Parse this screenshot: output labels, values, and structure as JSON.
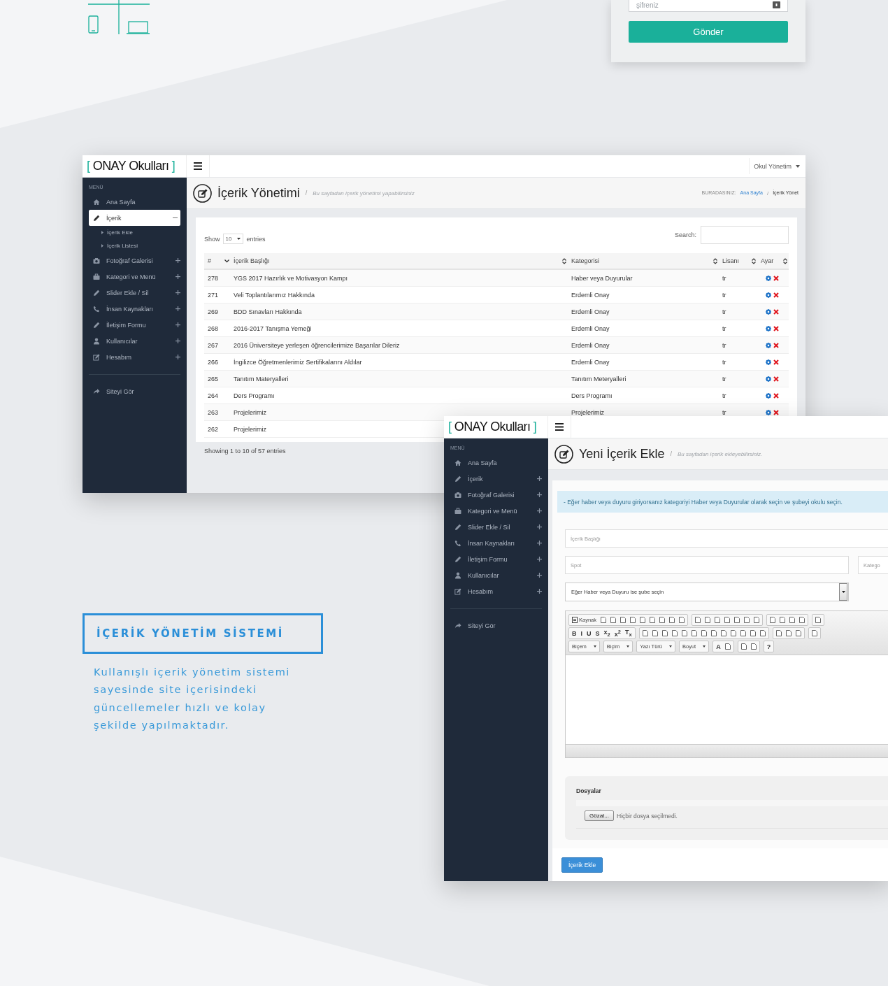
{
  "login_card": {
    "password": {
      "placeholder": "şifreniz"
    },
    "submit": "Gönder"
  },
  "list_window": {
    "logo": {
      "open": "[",
      "name": "ONAY Okulları",
      "close": "]"
    },
    "user_menu": "Okul Yönetim",
    "sidebar": {
      "menu_label": "MENÜ",
      "items": [
        {
          "label": "Ana Sayfa",
          "kind": "link",
          "selected": false
        },
        {
          "label": "İçerik",
          "kind": "group",
          "selected": true,
          "expanded": true,
          "children": [
            {
              "label": "İçerik Ekle"
            },
            {
              "label": "İçerik Listesi"
            }
          ]
        },
        {
          "label": "Fotoğraf Galerisi",
          "kind": "group",
          "selected": false,
          "expanded": false
        },
        {
          "label": "Kategori ve Menü",
          "kind": "group",
          "selected": false,
          "expanded": false
        },
        {
          "label": "Slider Ekle / Sil",
          "kind": "group",
          "selected": false,
          "expanded": false
        },
        {
          "label": "İnsan Kaynakları",
          "kind": "group",
          "selected": false,
          "expanded": false
        },
        {
          "label": "İletişim Formu",
          "kind": "group",
          "selected": false,
          "expanded": false
        },
        {
          "label": "Kullanıcılar",
          "kind": "group",
          "selected": false,
          "expanded": false
        },
        {
          "label": "Hesabım",
          "kind": "group",
          "selected": false,
          "expanded": false
        }
      ],
      "footer_item": "Siteyi Gör"
    },
    "page": {
      "title": "İçerik Yönetimi",
      "separator": "/",
      "subtitle": "Bu sayfadan içerik yönetimi yapabilirsiniz",
      "breadcrumb": {
        "label": "BURADASINIZ:",
        "separator": "/",
        "items": [
          {
            "text": "Ana Sayfa",
            "link": true
          },
          {
            "text": "İçerik Yönet",
            "link": false
          }
        ]
      }
    },
    "table": {
      "show": "Show",
      "length": "10",
      "entries": "entries",
      "search_label": "Search:",
      "columns": [
        {
          "label": "#",
          "sorted": true
        },
        {
          "label": "İçerik Başlığı",
          "sorted": false
        },
        {
          "label": "Kategorisi",
          "sorted": false
        },
        {
          "label": "Lisanı",
          "sorted": false
        },
        {
          "label": "Ayar",
          "sorted": false
        }
      ],
      "rows": [
        {
          "id": "278",
          "title": "YGS 2017 Hazırlık ve Motivasyon Kampı",
          "category": "Haber veya Duyurular",
          "language": "tr"
        },
        {
          "id": "271",
          "title": "Veli Toplantılarımız Hakkında",
          "category": "Erdemli Onay",
          "language": "tr"
        },
        {
          "id": "269",
          "title": "BDD Sınavları Hakkında",
          "category": "Erdemli Onay",
          "language": "tr"
        },
        {
          "id": "268",
          "title": "2016-2017 Tanışma Yemeği",
          "category": "Erdemli Onay",
          "language": "tr"
        },
        {
          "id": "267",
          "title": "2016 Üniversiteye yerleşen öğrencilerimize Başarılar Dileriz",
          "category": "Erdemli Onay",
          "language": "tr"
        },
        {
          "id": "266",
          "title": "İngilizce Öğretmenlerimiz Sertifikalarını Aldılar",
          "category": "Erdemli Onay",
          "language": "tr"
        },
        {
          "id": "265",
          "title": "Tanıtım Materyalleri",
          "category": "Tanıtım Meteryalleri",
          "language": "tr"
        },
        {
          "id": "264",
          "title": "Ders Programı",
          "category": "Ders Programı",
          "language": "tr"
        },
        {
          "id": "263",
          "title": "Projelerimiz",
          "category": "Projelerimiz",
          "language": "tr"
        },
        {
          "id": "262",
          "title": "Projelerimiz"
        }
      ],
      "info": "Showing 1 to 10 of 57 entries"
    }
  },
  "form_window": {
    "logo": {
      "open": "[",
      "name": "ONAY Okulları",
      "close": "]"
    },
    "sidebar": {
      "menu_label": "MENÜ",
      "items": [
        {
          "label": "Ana Sayfa",
          "kind": "link",
          "selected": false
        },
        {
          "label": "İçerik",
          "kind": "group",
          "selected": false,
          "expanded": false
        },
        {
          "label": "Fotoğraf Galerisi",
          "kind": "group",
          "selected": false,
          "expanded": false
        },
        {
          "label": "Kategori ve Menü",
          "kind": "group",
          "selected": false,
          "expanded": false
        },
        {
          "label": "Slider Ekle / Sil",
          "kind": "group",
          "selected": false,
          "expanded": false
        },
        {
          "label": "İnsan Kaynakları",
          "kind": "group",
          "selected": false,
          "expanded": false
        },
        {
          "label": "İletişim Formu",
          "kind": "group",
          "selected": false,
          "expanded": false
        },
        {
          "label": "Kullanıcılar",
          "kind": "group",
          "selected": false,
          "expanded": false
        },
        {
          "label": "Hesabım",
          "kind": "group",
          "selected": false,
          "expanded": false
        }
      ],
      "footer_item": "Siteyi Gör"
    },
    "page": {
      "title": "Yeni İçerik Ekle",
      "separator": "/",
      "subtitle": "Bu sayfadan içerik ekleyebilirsiniz."
    },
    "alert": "- Eğer haber veya duyuru giriyorsanız kategoriyi Haber veya Duyurular olarak seçin ve şubeyi okulu seçin.",
    "title_field": {
      "placeholder": "İçerik Başlığı"
    },
    "spot_field": {
      "placeholder": "Spot"
    },
    "category_field": {
      "placeholder": "Katego"
    },
    "branch_select": {
      "value": "Eğer Haber veya Duyuru ise şube seçin"
    },
    "editor": {
      "toolbar": [
        [
          [
            {
              "kind": "source",
              "text": "Kaynak"
            },
            {
              "kind": "icon"
            },
            {
              "kind": "icon"
            },
            {
              "kind": "icon"
            },
            {
              "kind": "icon"
            },
            {
              "kind": "icon"
            },
            {
              "kind": "icon"
            },
            {
              "kind": "icon"
            },
            {
              "kind": "icon"
            },
            {
              "kind": "icon"
            }
          ],
          [
            {
              "kind": "icon"
            },
            {
              "kind": "icon"
            },
            {
              "kind": "icon"
            },
            {
              "kind": "icon"
            },
            {
              "kind": "icon"
            },
            {
              "kind": "icon"
            },
            {
              "kind": "icon"
            }
          ],
          [
            {
              "kind": "icon"
            },
            {
              "kind": "icon"
            },
            {
              "kind": "icon"
            },
            {
              "kind": "icon"
            }
          ],
          [
            {
              "kind": "icon"
            }
          ]
        ],
        [
          [
            {
              "kind": "glyph",
              "text": "B"
            },
            {
              "kind": "glyph",
              "text": "I"
            },
            {
              "kind": "glyph",
              "text": "U"
            },
            {
              "kind": "glyph",
              "text": "S"
            },
            {
              "kind": "glyph",
              "text": "x$_{2}$"
            },
            {
              "kind": "glyph",
              "text": "x$^{2}$"
            },
            {
              "kind": "glyph",
              "text": "T$_{x}$"
            }
          ],
          [
            {
              "kind": "icon"
            },
            {
              "kind": "icon"
            },
            {
              "kind": "icon"
            },
            {
              "kind": "icon"
            },
            {
              "kind": "icon"
            },
            {
              "kind": "icon"
            },
            {
              "kind": "icon"
            },
            {
              "kind": "icon"
            },
            {
              "kind": "icon"
            },
            {
              "kind": "icon"
            },
            {
              "kind": "icon"
            },
            {
              "kind": "icon"
            },
            {
              "kind": "icon"
            }
          ],
          [
            {
              "kind": "icon"
            },
            {
              "kind": "icon"
            },
            {
              "kind": "icon"
            }
          ],
          [
            {
              "kind": "icon"
            }
          ]
        ],
        [
          [
            {
              "kind": "dropdown",
              "text": "Biçem"
            }
          ],
          [
            {
              "kind": "dropdown",
              "text": "Biçim"
            }
          ],
          [
            {
              "kind": "dropdown",
              "text": "Yazı Türü"
            }
          ],
          [
            {
              "kind": "dropdown",
              "text": "Boyut"
            }
          ],
          [
            {
              "kind": "glyph",
              "text": "A"
            },
            {
              "kind": "icon"
            }
          ],
          [
            {
              "kind": "icon"
            },
            {
              "kind": "icon"
            }
          ],
          [
            {
              "kind": "glyph",
              "text": "?"
            }
          ]
        ]
      ]
    },
    "files": {
      "legend": "Dosyalar",
      "browse": "Gözat...",
      "status": "Hiçbir dosya seçilmedi."
    },
    "submit": "İçerik Ekle"
  },
  "feature": {
    "title": "İÇERİK YÖNETİM SİSTEMİ",
    "text": "Kullanışlı içerik yönetim sistemi\nsayesinde site içerisindeki\ngüncellemeler hızlı ve kolay\nşekilde yapılmaktadır."
  }
}
